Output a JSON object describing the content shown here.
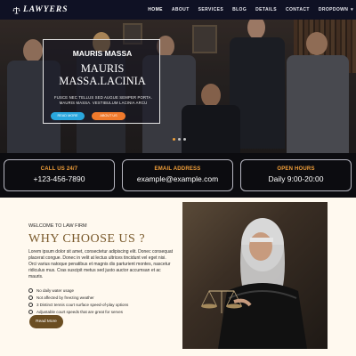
{
  "nav": {
    "logo_text": "LAWYERS",
    "items": [
      {
        "label": "HOME"
      },
      {
        "label": "ABOUT"
      },
      {
        "label": "SERVICES"
      },
      {
        "label": "BLOG"
      },
      {
        "label": "DETAILS"
      },
      {
        "label": "CONTACT"
      },
      {
        "label": "DROPDOWN"
      }
    ],
    "active_item": "HOME"
  },
  "hero": {
    "small_title": "MAURIS MASSA",
    "big_title": "MAURIS MASSA.LACINIA",
    "text": "FUSCE NEC TELLUS SED AUGUE SEMPER PORTA. MAURIS MASSA. VESTIBULUM LACINIA ARCU",
    "read_more": "READ MORE",
    "about_us": "ABOUT US",
    "active_slide": 1,
    "slide_count": 3
  },
  "contacts": [
    {
      "label": "CALL US 24/7",
      "value": "+123-456-7890"
    },
    {
      "label": "EMAIL ADDRESS",
      "value": "example@example.com"
    },
    {
      "label": "OPEN HOURS",
      "value": "Daily 9:00-20:00"
    }
  ],
  "why": {
    "welcome": "WELCOME TO LAW FIRM",
    "title": "WHY CHOOSE US ?",
    "paragraph": "Lorem ipsum dolor sit amet, consectetur adipiscing elit. Donec consequat placerat congue. Donec in velit at lectus ultrices tincidunt vel eget nisi. Orci varius natoque penatibus et magnis dis parturient montes, nascetur ridiculus mus. Cras suscipit metus sed justo auctor accumsan et ac mauris.",
    "checklist": [
      "No daily water usage",
      "Not affected by freezing weather",
      "3 Distinct tennis court surface speed-of-play options",
      "Adjustable court speeds that are great for serves"
    ],
    "read_more": "Read More"
  },
  "colors": {
    "nav_bg": "#0f1124",
    "accent_orange": "#f3a03a",
    "button_blue": "#2aa7dd",
    "button_orange": "#f07a2c",
    "title_brown": "#7a5a2c",
    "section_bg": "#fff9ef"
  },
  "icons": {
    "logo": "scales-of-justice-icon",
    "checklist": "check-circle-icon",
    "dropdown": "chevron-down-icon"
  }
}
